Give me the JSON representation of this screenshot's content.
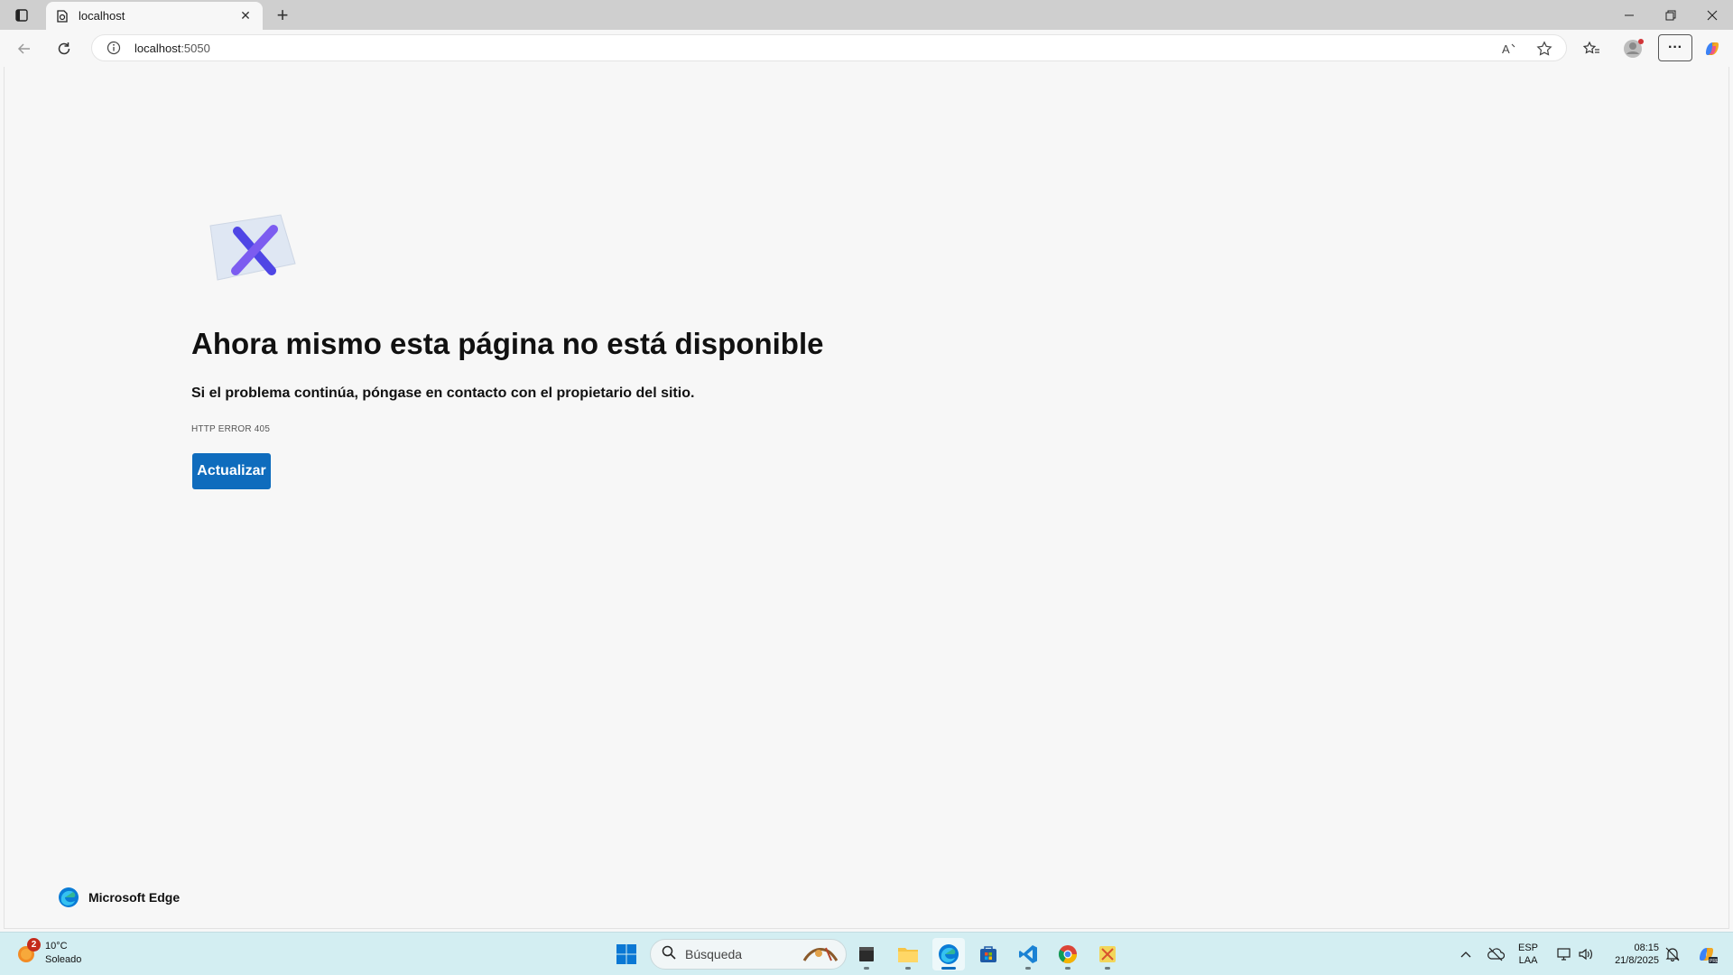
{
  "browser": {
    "tab": {
      "title": "localhost"
    },
    "address_bar": {
      "host": "localhost",
      "port": ":5050"
    }
  },
  "error_page": {
    "title": "Ahora mismo esta página no está disponible",
    "subtitle": "Si el problema continúa, póngase en contacto con el propietario del sitio.",
    "code": "HTTP ERROR 405",
    "reload_label": "Actualizar",
    "brand": "Microsoft Edge"
  },
  "taskbar": {
    "weather": {
      "temp": "10°C",
      "condition": "Soleado",
      "badge": "2"
    },
    "search_placeholder": "Búsqueda",
    "lang": {
      "line1": "ESP",
      "line2": "LAA"
    },
    "clock": {
      "time": "08:15",
      "date": "21/8/2025"
    }
  },
  "colors": {
    "accent": "#0f6cbd",
    "tabstrip": "#cfcfcf",
    "taskbar": "#d3eef2",
    "page_bg": "#f7f7f7"
  }
}
